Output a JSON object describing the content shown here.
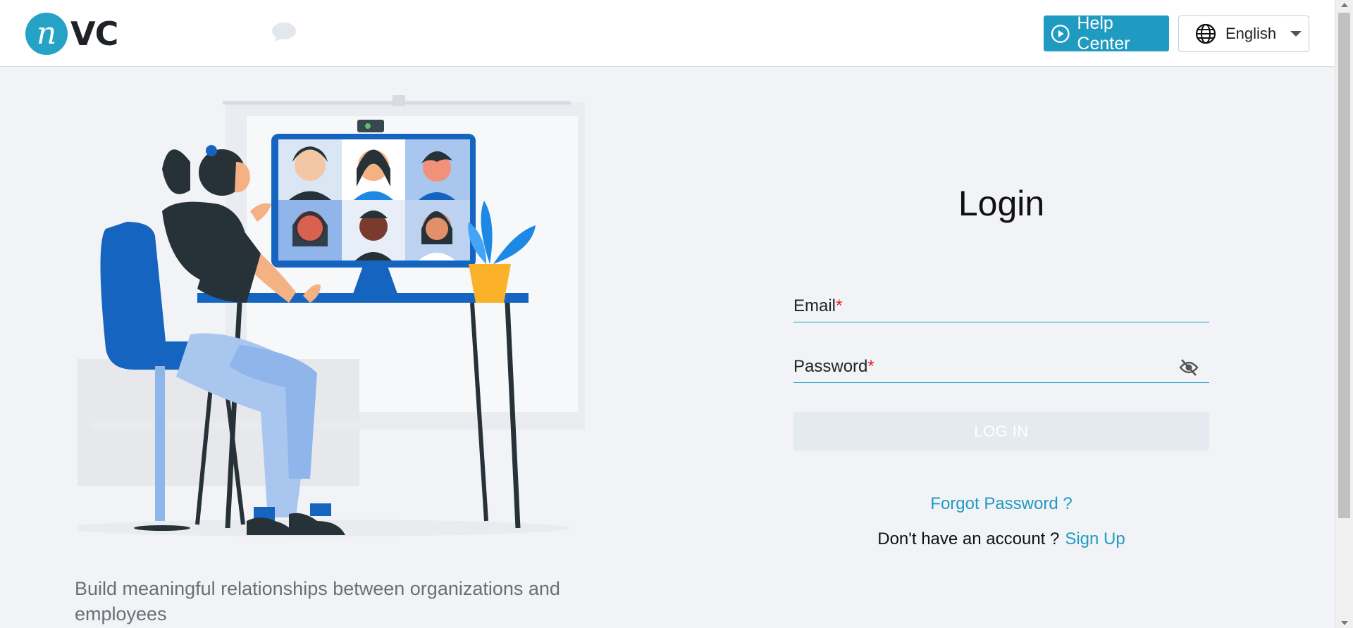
{
  "header": {
    "logo_letter": "n",
    "logo_text": "VC",
    "help_label": "Help Center",
    "language_label": "English"
  },
  "illustration": {
    "tagline": "Build meaningful relationships between organizations and employees"
  },
  "login": {
    "title": "Login",
    "email_label": "Email",
    "password_label": "Password",
    "required_mark": "*",
    "button_label": "LOG IN",
    "forgot_label": "Forgot Password ?",
    "no_account_text": "Don't have an account ?",
    "signup_label": "Sign Up"
  },
  "colors": {
    "accent": "#1f9bc2",
    "logo": "#24a3c6",
    "required": "#e0202a",
    "disabled_button": "#e5e9f0"
  },
  "icons": [
    "chat-bubble-icon",
    "play-circle-icon",
    "globe-icon",
    "chevron-down-icon",
    "eye-off-icon"
  ]
}
